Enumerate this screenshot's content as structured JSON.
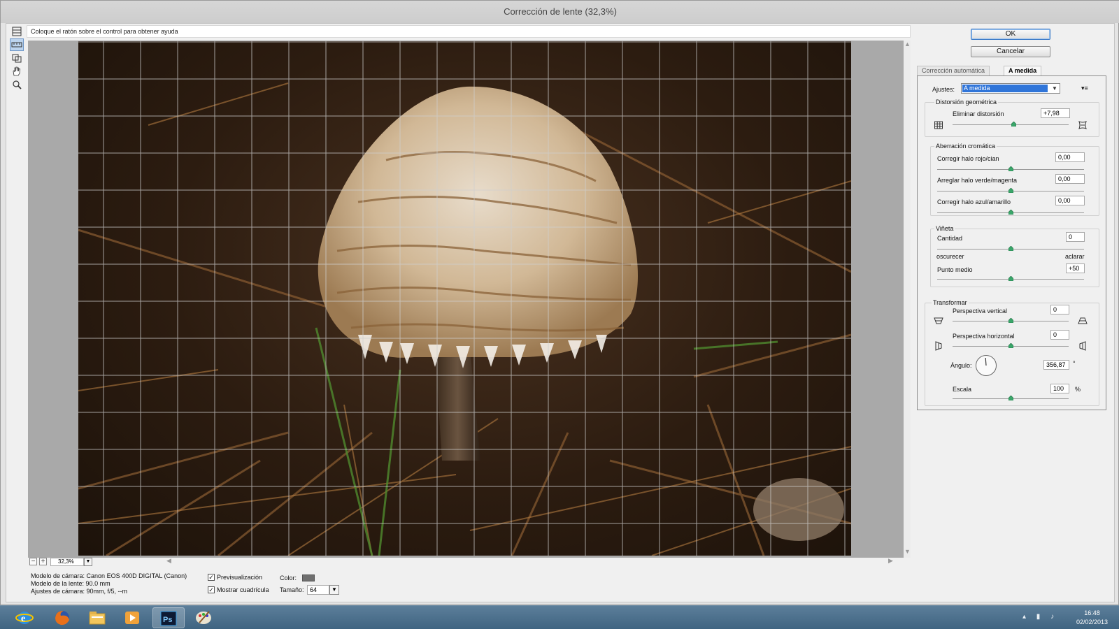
{
  "window": {
    "title": "Corrección de lente (32,3%)"
  },
  "hint": "Coloque el ratón sobre el control para obtener ayuda",
  "tools": [
    "remove-distortion-tool-icon",
    "straighten-tool-icon",
    "move-grid-tool-icon",
    "hand-tool-icon",
    "zoom-tool-icon"
  ],
  "zoom": {
    "minus": "−",
    "plus": "+",
    "value": "32,3%"
  },
  "camera_info": {
    "camera_model": "Modelo de cámara: Canon EOS 400D DIGITAL (Canon)",
    "lens_model": "Modelo de la lente: 90.0 mm",
    "camera_settings": "Ajustes de cámara: 90mm, f/5, --m"
  },
  "options": {
    "preview_label": "Previsualización",
    "preview_checked": "✓",
    "grid_label": "Mostrar cuadrícula",
    "grid_checked": "✓",
    "color_label": "Color:",
    "color_value": "#6f6f6f",
    "size_label": "Tamaño:",
    "size_value": "64"
  },
  "buttons": {
    "ok": "OK",
    "cancel": "Cancelar"
  },
  "tabs": {
    "auto": "Corrección automática",
    "custom": "A medida"
  },
  "panel": {
    "settings_label": "Ajustes:",
    "settings_value": "A medida",
    "menu_glyph": "▾≡",
    "geometric": {
      "title": "Distorsión geométrica",
      "remove_label": "Eliminar distorsión",
      "remove_value": "+7,98",
      "remove_position": 0.53
    },
    "chromatic": {
      "title": "Aberración cromática",
      "red_cyan_label": "Corregir halo rojo/cian",
      "red_cyan_value": "0,00",
      "green_magenta_label": "Arreglar halo verde/magenta",
      "green_magenta_value": "0,00",
      "blue_yellow_label": "Corregir halo azul/amarillo",
      "blue_yellow_value": "0,00"
    },
    "vignette": {
      "title": "Viñeta",
      "amount_label": "Cantidad",
      "amount_value": "0",
      "darken_label": "oscurecer",
      "lighten_label": "aclarar",
      "midpoint_label": "Punto medio",
      "midpoint_value": "+50"
    },
    "transform": {
      "title": "Transformar",
      "vertical_label": "Perspectiva vertical",
      "vertical_value": "0",
      "horizontal_label": "Perspectiva horizontal",
      "horizontal_value": "0",
      "angle_label": "Ángulo:",
      "angle_value": "356,87",
      "angle_unit": "°",
      "scale_label": "Escala",
      "scale_value": "100",
      "scale_unit": "%"
    }
  },
  "taskbar": {
    "apps": [
      "internet-explorer-icon",
      "firefox-icon",
      "file-explorer-icon",
      "media-player-icon",
      "photoshop-icon",
      "paint-icon"
    ],
    "photoshop_label": "Ps",
    "time": "16:48",
    "date": "02/02/2013"
  }
}
